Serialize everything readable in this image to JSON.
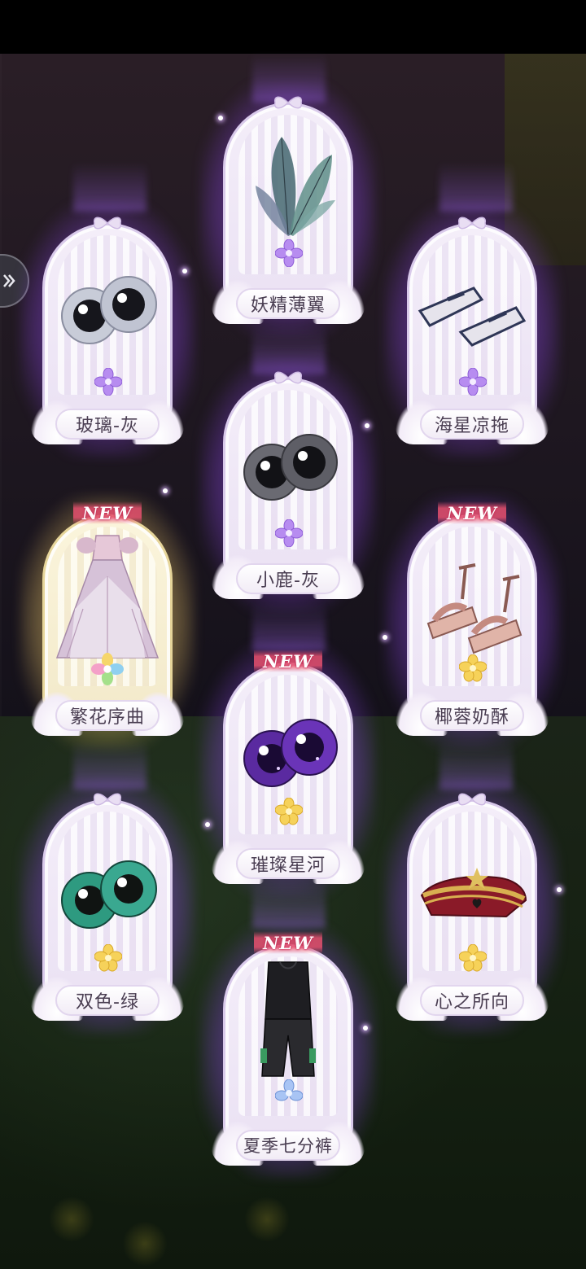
{
  "colors": {
    "purple_glow": "#a864ff",
    "gold_glow": "#f5d78a",
    "label_text": "#4a3e52",
    "new_badge": "#e6506e"
  },
  "side_button": {
    "icon": "double-chevron-right-icon"
  },
  "cards": [
    {
      "id": "fairy-wings",
      "label": "妖精薄翼",
      "rarity_icon": "purple-flower-icon",
      "new": false,
      "glow": "purple",
      "item": "wings"
    },
    {
      "id": "glass-gray",
      "label": "玻璃-灰",
      "rarity_icon": "purple-flower-icon",
      "new": false,
      "glow": "purple",
      "item": "eyes-gray"
    },
    {
      "id": "starfish-slippers",
      "label": "海星凉拖",
      "rarity_icon": "purple-flower-icon",
      "new": false,
      "glow": "purple",
      "item": "slippers"
    },
    {
      "id": "fawn-gray",
      "label": "小鹿-灰",
      "rarity_icon": "purple-flower-icon",
      "new": false,
      "glow": "purple",
      "item": "eyes-dark"
    },
    {
      "id": "flower-prelude",
      "label": "繁花序曲",
      "rarity_icon": "rainbow-flower-icon",
      "new": true,
      "new_text": "NEW",
      "glow": "gold",
      "item": "dress"
    },
    {
      "id": "coconut-pastry",
      "label": "椰蓉奶酥",
      "rarity_icon": "gold-flower-icon",
      "new": true,
      "new_text": "NEW",
      "glow": "purple",
      "item": "sandals"
    },
    {
      "id": "bright-galaxy",
      "label": "璀璨星河",
      "rarity_icon": "gold-flower-icon",
      "new": true,
      "new_text": "NEW",
      "glow": "purple",
      "item": "eyes-galaxy"
    },
    {
      "id": "two-tone-green",
      "label": "双色-绿",
      "rarity_icon": "gold-flower-icon",
      "new": false,
      "glow": "purple",
      "item": "eyes-green"
    },
    {
      "id": "heart-direction",
      "label": "心之所向",
      "rarity_icon": "gold-flower-icon",
      "new": false,
      "glow": "purple",
      "item": "hat"
    },
    {
      "id": "summer-capris",
      "label": "夏季七分裤",
      "rarity_icon": "blue-flower-icon",
      "new": true,
      "new_text": "NEW",
      "glow": "purple",
      "item": "outfit"
    }
  ]
}
